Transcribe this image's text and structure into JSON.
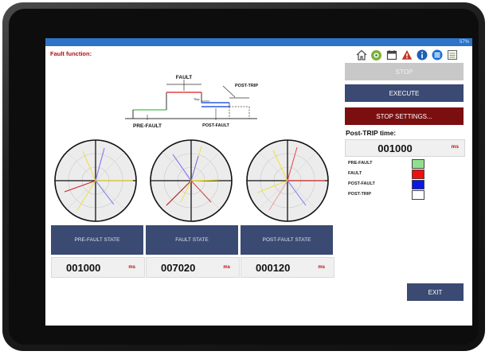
{
  "app": {
    "title": "Fault function:",
    "status_text": "57%"
  },
  "toolbar": {
    "icons": [
      "home-icon",
      "settings-icon",
      "calendar-icon",
      "warning-icon",
      "info-icon",
      "menu-icon",
      "notes-icon"
    ]
  },
  "buttons": {
    "stop": "STOP",
    "execute": "EXECUTE",
    "stop_settings": "STOP SETTINGS...",
    "exit": "EXIT"
  },
  "post_trip": {
    "label": "Post-TRIP time:",
    "value": "001000",
    "unit": "ms"
  },
  "legend": [
    {
      "label": "PRE-FAULT",
      "color": "#8ee08e"
    },
    {
      "label": "FAULT",
      "color": "#ee0f0f"
    },
    {
      "label": "POST-FAULT",
      "color": "#0b17e6"
    },
    {
      "label": "POST-TRIP",
      "color": "#ffffff"
    }
  ],
  "diagram": {
    "fault": "FAULT",
    "post_trip": "POST-TRIP",
    "pre_fault": "PRE-FAULT",
    "post_fault": "POST-FAULT",
    "ttrip": "Ttrip"
  },
  "states": [
    {
      "label": "PRE-FAULT STATE",
      "value": "001000",
      "unit": "ms"
    },
    {
      "label": "FAULT STATE",
      "value": "007020",
      "unit": "ms"
    },
    {
      "label": "POST-FAULT STATE",
      "value": "000120",
      "unit": "ms"
    }
  ],
  "colors": {
    "navy": "#3a4a73",
    "dark_red": "#7b0f10",
    "disabled": "#c8c8c8",
    "status_blue": "#2c73c9"
  }
}
